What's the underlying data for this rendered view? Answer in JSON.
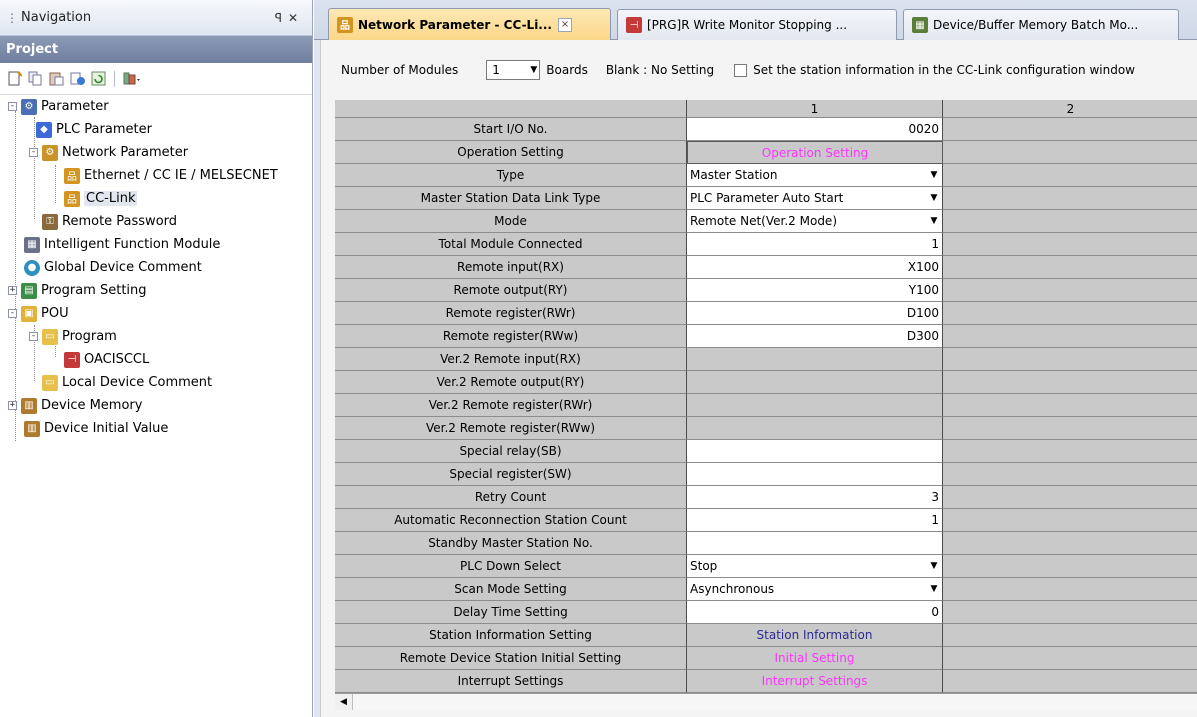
{
  "navigation": {
    "title": "Navigation",
    "pin_icon": "pin-icon",
    "close_icon": "close-icon",
    "section": "Project",
    "toolbar_icons": [
      "new-item-icon",
      "copy-icon",
      "paste-icon",
      "properties-icon",
      "refresh-icon",
      "filter-icon"
    ],
    "tree": [
      {
        "label": "Parameter",
        "level": 0,
        "expander": "-",
        "icon": "parameter-icon"
      },
      {
        "label": "PLC Parameter",
        "level": 1,
        "expander": "",
        "icon": "plc-parameter-icon"
      },
      {
        "label": "Network Parameter",
        "level": 1,
        "expander": "-",
        "icon": "network-parameter-icon"
      },
      {
        "label": "Ethernet / CC IE / MELSECNET",
        "level": 2,
        "expander": "",
        "icon": "network-icon"
      },
      {
        "label": "CC-Link",
        "level": 2,
        "expander": "",
        "icon": "network-icon",
        "selected": true
      },
      {
        "label": "Remote Password",
        "level": 1,
        "expander": "",
        "icon": "password-icon"
      },
      {
        "label": "Intelligent Function Module",
        "level": 0,
        "expander": "",
        "icon": "module-icon"
      },
      {
        "label": "Global Device Comment",
        "level": 0,
        "expander": "",
        "icon": "comment-icon"
      },
      {
        "label": "Program Setting",
        "level": 0,
        "expander": "+",
        "icon": "program-setting-icon"
      },
      {
        "label": "POU",
        "level": 0,
        "expander": "-",
        "icon": "pou-icon"
      },
      {
        "label": "Program",
        "level": 1,
        "expander": "-",
        "icon": "folder-icon"
      },
      {
        "label": "OACISCCL",
        "level": 2,
        "expander": "",
        "icon": "ladder-program-icon"
      },
      {
        "label": "Local Device Comment",
        "level": 1,
        "expander": "",
        "icon": "folder-icon"
      },
      {
        "label": "Device Memory",
        "level": 0,
        "expander": "+",
        "icon": "device-memory-icon"
      },
      {
        "label": "Device Initial Value",
        "level": 0,
        "expander": "",
        "icon": "device-initial-icon"
      }
    ]
  },
  "tabs": [
    {
      "label": "Network Parameter - CC-Li...",
      "active": true,
      "icon": "network-icon",
      "close": "×"
    },
    {
      "label": "[PRG]R Write Monitor Stopping ...",
      "active": false,
      "icon": "ladder-program-icon"
    },
    {
      "label": "Device/Buffer Memory Batch Mo...",
      "active": false,
      "icon": "memory-batch-icon"
    }
  ],
  "settings_bar": {
    "modules_label": "Number of Modules",
    "modules_value": "1",
    "boards_label": "Boards",
    "blank_note": "Blank : No Setting",
    "checkbox_label": "Set the station information in the CC-Link configuration window",
    "checkbox_checked": false
  },
  "grid": {
    "columns": [
      "1",
      "2"
    ],
    "rows": [
      {
        "label": "Start I/O No.",
        "value": "0020",
        "kind": "right"
      },
      {
        "label": "Operation Setting",
        "value": "Operation Setting",
        "kind": "button-pink-framed"
      },
      {
        "label": "Type",
        "value": "Master Station",
        "kind": "combo"
      },
      {
        "label": "Master Station Data Link Type",
        "value": "PLC Parameter Auto Start",
        "kind": "combo"
      },
      {
        "label": "Mode",
        "value": "Remote Net(Ver.2 Mode)",
        "kind": "combo"
      },
      {
        "label": "Total Module Connected",
        "value": "1",
        "kind": "right"
      },
      {
        "label": "Remote input(RX)",
        "value": "X100",
        "kind": "right"
      },
      {
        "label": "Remote output(RY)",
        "value": "Y100",
        "kind": "right"
      },
      {
        "label": "Remote register(RWr)",
        "value": "D100",
        "kind": "right"
      },
      {
        "label": "Remote register(RWw)",
        "value": "D300",
        "kind": "right"
      },
      {
        "label": "Ver.2 Remote input(RX)",
        "value": "",
        "kind": "gray"
      },
      {
        "label": "Ver.2 Remote output(RY)",
        "value": "",
        "kind": "gray"
      },
      {
        "label": "Ver.2 Remote register(RWr)",
        "value": "",
        "kind": "gray"
      },
      {
        "label": "Ver.2 Remote register(RWw)",
        "value": "",
        "kind": "gray"
      },
      {
        "label": "Special relay(SB)",
        "value": "",
        "kind": "right"
      },
      {
        "label": "Special register(SW)",
        "value": "",
        "kind": "right"
      },
      {
        "label": "Retry Count",
        "value": "3",
        "kind": "right"
      },
      {
        "label": "Automatic Reconnection Station Count",
        "value": "1",
        "kind": "right"
      },
      {
        "label": "Standby Master Station No.",
        "value": "",
        "kind": "right"
      },
      {
        "label": "PLC Down Select",
        "value": "Stop",
        "kind": "combo"
      },
      {
        "label": "Scan Mode Setting",
        "value": "Asynchronous",
        "kind": "combo"
      },
      {
        "label": "Delay Time Setting",
        "value": "0",
        "kind": "right"
      },
      {
        "label": "Station Information Setting",
        "value": "Station Information",
        "kind": "button-navy"
      },
      {
        "label": "Remote Device Station Initial Setting",
        "value": "Initial Setting",
        "kind": "button-pink"
      },
      {
        "label": "Interrupt Settings",
        "value": "Interrupt Settings",
        "kind": "button-pink"
      }
    ]
  },
  "colors": {
    "pink_text": "#ff33ff",
    "navy_text": "#2b2b8f",
    "active_tab": "#fbd888",
    "grid_gray": "#c9c9c9"
  }
}
